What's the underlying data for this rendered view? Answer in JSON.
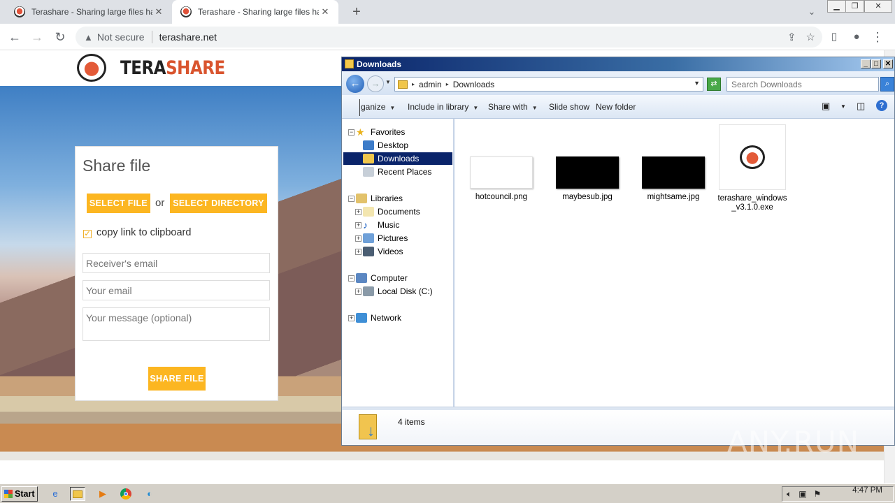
{
  "browser": {
    "tabs": [
      {
        "title": "Terashare - Sharing large files has never",
        "active": false
      },
      {
        "title": "Terashare - Sharing large files has never",
        "active": true
      }
    ],
    "new_tab": "+",
    "omnibox": {
      "security": "Not secure",
      "url": "terashare.net"
    }
  },
  "site": {
    "logo": {
      "tera": "TERA",
      "share": "SHARE"
    },
    "card": {
      "title": "Share file",
      "select_file": "SELECT FILE",
      "or": "or",
      "select_directory": "SELECT DIRECTORY",
      "copy_link": "copy link to clipboard",
      "copy_link_checked": true,
      "receiver_placeholder": "Receiver's email",
      "your_email_placeholder": "Your email",
      "message_placeholder": "Your message (optional)",
      "share_button": "SHARE FILE"
    },
    "accent_color": "#fcb621"
  },
  "explorer": {
    "title": "Downloads",
    "breadcrumb": [
      "admin",
      "Downloads"
    ],
    "search_placeholder": "Search Downloads",
    "commands": [
      "ganize",
      "Include in library",
      "Share with",
      "Slide show",
      "New folder"
    ],
    "nav": {
      "favorites": {
        "label": "Favorites",
        "items": [
          "Desktop",
          "Downloads",
          "Recent Places"
        ]
      },
      "libraries": {
        "label": "Libraries",
        "items": [
          "Documents",
          "Music",
          "Pictures",
          "Videos"
        ]
      },
      "computer": {
        "label": "Computer",
        "items": [
          "Local Disk (C:)"
        ]
      },
      "network": {
        "label": "Network"
      }
    },
    "files": [
      {
        "name": "hotcouncil.png"
      },
      {
        "name": "maybesub.jpg"
      },
      {
        "name": "mightsame.jpg"
      },
      {
        "name": "terashare_windows_v3.1.0.exe"
      }
    ],
    "status": "4 items"
  },
  "watermark": "ANY.RUN",
  "taskbar": {
    "start": "Start",
    "clock": "4:47 PM"
  }
}
